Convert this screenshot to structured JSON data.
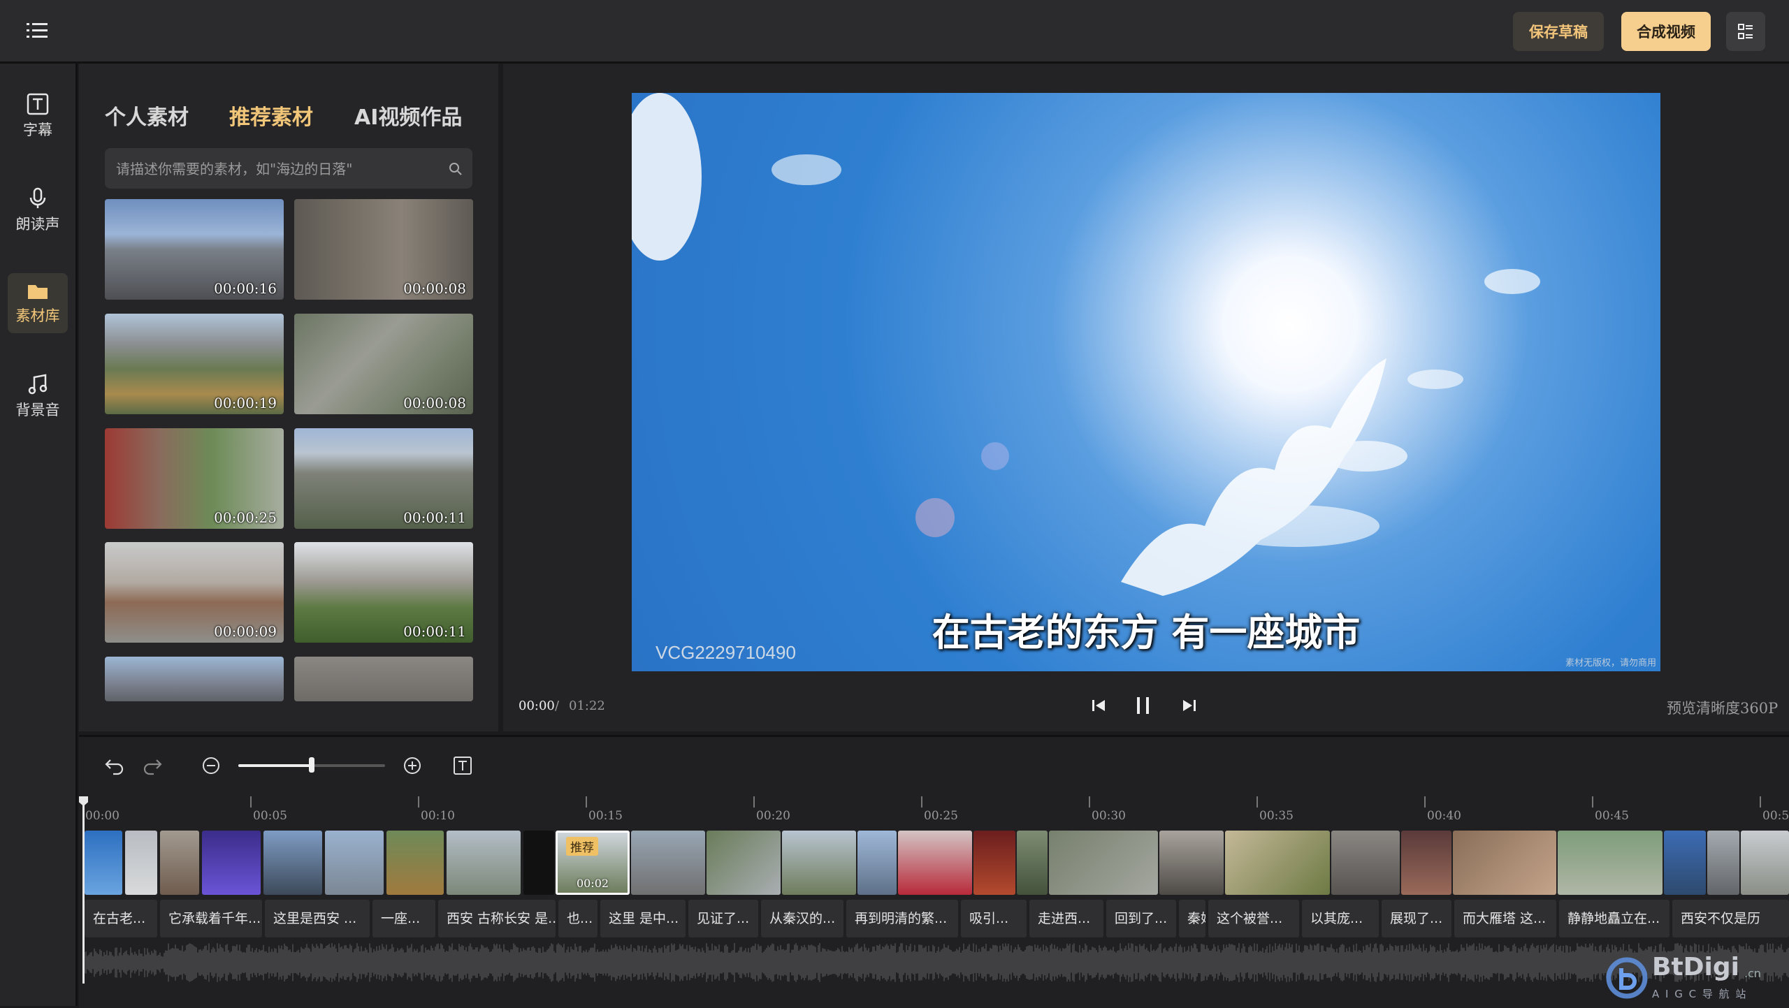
{
  "topbar": {
    "save_draft": "保存草稿",
    "compose_video": "合成视频",
    "accent": "#f6cf8f"
  },
  "rail": {
    "items": [
      {
        "label": "字幕",
        "icon": "text-icon"
      },
      {
        "label": "朗读声",
        "icon": "microphone-icon"
      },
      {
        "label": "素材库",
        "icon": "folder-icon",
        "active": true
      },
      {
        "label": "背景音",
        "icon": "music-note-icon"
      }
    ]
  },
  "library": {
    "tabs": [
      {
        "label": "个人素材",
        "active": false
      },
      {
        "label": "推荐素材",
        "active": true
      },
      {
        "label": "AI视频作品",
        "active": false
      }
    ],
    "search_placeholder": "请描述你需要的素材，如\"海边的日落\"",
    "thumbnails": [
      {
        "duration": "00:00:16"
      },
      {
        "duration": "00:00:08"
      },
      {
        "duration": "00:00:19"
      },
      {
        "duration": "00:00:08"
      },
      {
        "duration": "00:00:25"
      },
      {
        "duration": "00:00:11"
      },
      {
        "duration": "00:00:09"
      },
      {
        "duration": "00:00:11"
      },
      {
        "duration": ""
      },
      {
        "duration": ""
      }
    ]
  },
  "preview": {
    "subtitle": "在古老的东方 有一座城市",
    "watermark": "VCG2229710490",
    "corner_note": "素材无版权，请勿商用",
    "current_time": "00:00",
    "separator": "/",
    "total_time": "01:22",
    "quality": "预览清晰度360P"
  },
  "timeline": {
    "ruler_labels": [
      "00:00",
      "00:05",
      "00:10",
      "00:15",
      "00:20",
      "00:25",
      "00:30",
      "00:35",
      "00:40",
      "00:45",
      "00:5"
    ],
    "selected_clip": {
      "badge": "推荐",
      "duration": "00:02"
    },
    "text_segments": [
      "在古老...",
      "它承载着千年...",
      "这里是西安 ...",
      "一座...",
      "西安 古称长安 是...",
      "也...",
      "这里 是中...",
      "见证了...",
      "从秦汉的...",
      "再到明清的繁...",
      "吸引...",
      "走进西...",
      "回到了...",
      "秦始",
      "这个被誉...",
      "以其庞...",
      "展现了...",
      "而大雁塔 这...",
      "静静地矗立在...",
      "西安不仅是历"
    ]
  },
  "logo": {
    "name": "BtDigi",
    "suffix": ".cn",
    "tagline": "A I G C 导 航 站"
  }
}
